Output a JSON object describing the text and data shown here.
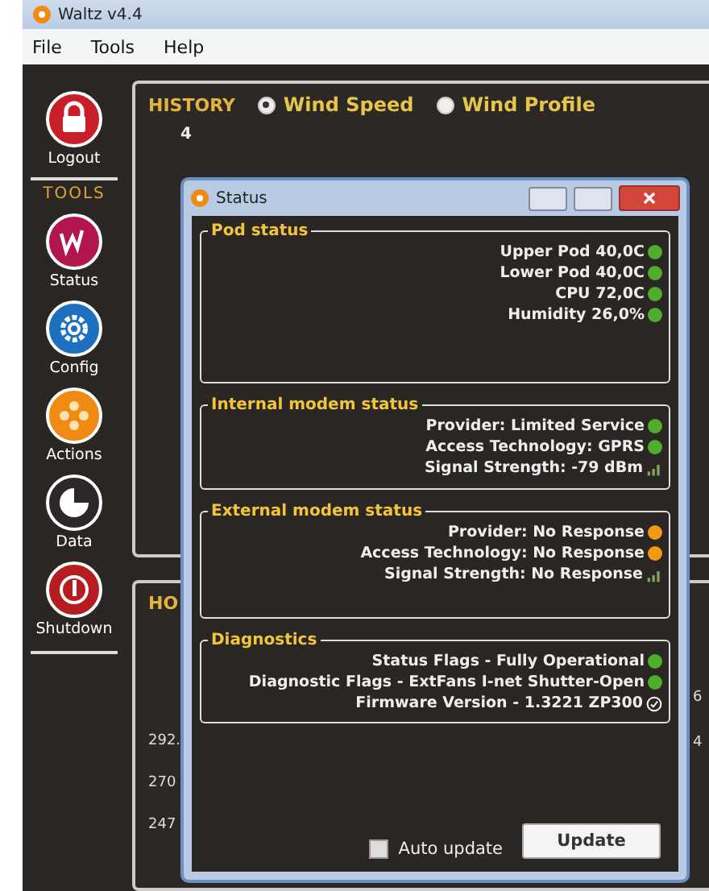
{
  "window": {
    "title": "Waltz v4.4"
  },
  "menu": [
    "File",
    "Tools",
    "Help"
  ],
  "sidebar": {
    "logout": {
      "label": "Logout",
      "kind": "lock"
    },
    "tools_heading": "TOOLS",
    "tools": [
      {
        "label": "Status",
        "kind": "wave"
      },
      {
        "label": "Config",
        "kind": "gear"
      },
      {
        "label": "Actions",
        "kind": "dots"
      },
      {
        "label": "Data",
        "kind": "pie"
      },
      {
        "label": "Shutdown",
        "kind": "power"
      }
    ]
  },
  "history": {
    "title": "HISTORY",
    "options": [
      {
        "label": "Wind Speed",
        "selected": true
      },
      {
        "label": "Wind Profile",
        "selected": false
      }
    ],
    "axis_label": "4"
  },
  "lower_panel": {
    "title": "HO",
    "axis_labels": [
      "292.",
      "270",
      "247"
    ],
    "right_labels": [
      "6",
      "4"
    ]
  },
  "status_dialog": {
    "title": "Status",
    "groups": [
      {
        "title": "Pod status",
        "rows": [
          {
            "text": "Upper Pod 40,0C",
            "kind": "led",
            "color": "#4fae2c"
          },
          {
            "text": "Lower Pod 40,0C",
            "kind": "led",
            "color": "#4fae2c"
          },
          {
            "text": "CPU 72,0C",
            "kind": "led",
            "color": "#4fae2c"
          },
          {
            "text": "Humidity 26,0%",
            "kind": "led",
            "color": "#4fae2c"
          }
        ]
      },
      {
        "title": "Internal modem status",
        "rows": [
          {
            "text": "Provider: Limited Service",
            "kind": "led",
            "color": "#4fae2c"
          },
          {
            "text": "Access Technology: GPRS",
            "kind": "led",
            "color": "#4fae2c"
          },
          {
            "text": "Signal Strength: -79 dBm",
            "kind": "signal"
          }
        ]
      },
      {
        "title": "External modem status",
        "rows": [
          {
            "text": "Provider: No Response",
            "kind": "led",
            "color": "#f29a13"
          },
          {
            "text": "Access Technology: No Response",
            "kind": "led",
            "color": "#f29a13"
          },
          {
            "text": "Signal Strength: No Response",
            "kind": "signal"
          }
        ]
      },
      {
        "title": "Diagnostics",
        "rows": [
          {
            "text": "Status Flags - Fully Operational",
            "kind": "led",
            "color": "#4fae2c"
          },
          {
            "text": "Diagnostic Flags - ExtFans I-net Shutter-Open",
            "kind": "led",
            "color": "#4fae2c"
          },
          {
            "text": "Firmware Version - 1.3221 ZP300",
            "kind": "check"
          }
        ]
      }
    ],
    "auto_update": {
      "label": "Auto update",
      "checked": false
    },
    "update_button": "Update"
  }
}
